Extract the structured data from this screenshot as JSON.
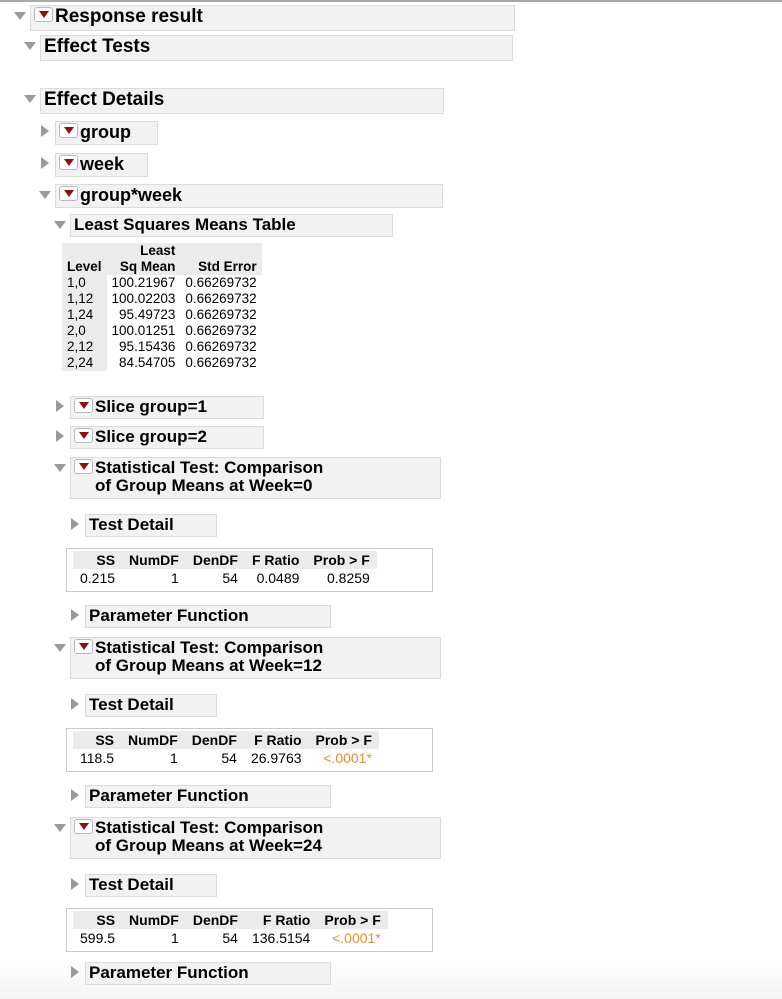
{
  "report": {
    "title": "Response result",
    "sections": {
      "effect_tests": "Effect Tests",
      "effect_details": "Effect Details",
      "group": "group",
      "week": "week",
      "group_week": "group*week",
      "lsm_title": "Least Squares Means Table",
      "slice_group_1": "Slice group=1",
      "slice_group_2": "Slice group=2",
      "test_detail": "Test Detail",
      "parameter_function": "Parameter Function"
    },
    "tests": [
      {
        "title": "Statistical Test: Comparison\nof Group Means at Week=0"
      },
      {
        "title": "Statistical Test: Comparison\nof Group Means at Week=12"
      },
      {
        "title": "Statistical Test: Comparison\nof Group Means at Week=24"
      }
    ]
  },
  "lsmeans": {
    "headers": [
      "Level",
      "Least\nSq Mean",
      "Std Error"
    ],
    "rows": [
      [
        "1,0",
        "100.21967",
        "0.66269732"
      ],
      [
        "1,12",
        "100.02203",
        "0.66269732"
      ],
      [
        "1,24",
        "95.49723",
        "0.66269732"
      ],
      [
        "2,0",
        "100.01251",
        "0.66269732"
      ],
      [
        "2,12",
        "95.15436",
        "0.66269732"
      ],
      [
        "2,24",
        "84.54705",
        "0.66269732"
      ]
    ]
  },
  "ftables": {
    "headers": [
      "SS",
      "NumDF",
      "DenDF",
      "F Ratio",
      "Prob > F"
    ],
    "week0": {
      "ss": "0.215",
      "numdf": "1",
      "dendf": "54",
      "fratio": "0.0489",
      "prob": "0.8259",
      "significant": false
    },
    "week12": {
      "ss": "118.5",
      "numdf": "1",
      "dendf": "54",
      "fratio": "26.9763",
      "prob": "<.0001*",
      "significant": true
    },
    "week24": {
      "ss": "599.5",
      "numdf": "1",
      "dendf": "54",
      "fratio": "136.5154",
      "prob": "<.0001*",
      "significant": true
    }
  },
  "colors": {
    "significant": "#e0902f",
    "dropdown_red": "#8e1010",
    "panel_gray": "#f2f2f2"
  },
  "icons": {
    "expanded": "triangle-down-icon",
    "collapsed": "triangle-right-icon",
    "menu": "red-dropdown-icon"
  }
}
